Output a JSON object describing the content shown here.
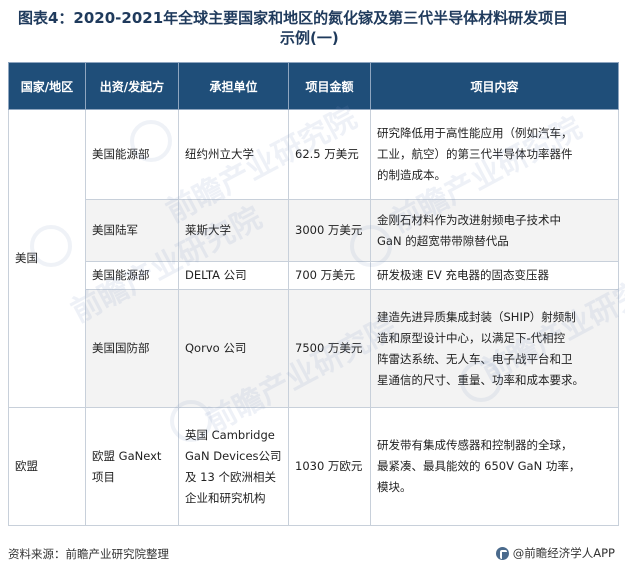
{
  "title": {
    "line1": "图表4：2020-2021年全球主要国家和地区的氮化镓及第三代半导体材料研发项目",
    "line2": "示例(一)"
  },
  "table": {
    "headers": [
      "国家/地区",
      "出资/发起方",
      "承担单位",
      "项目金额",
      "项目内容"
    ],
    "regions": {
      "usa": "美国",
      "europe": "欧盟"
    },
    "rows": [
      {
        "funder": "美国能源部",
        "unit": [
          "纽约州立大学"
        ],
        "amount": "62.5 万美元",
        "content": [
          "研究降低用于高性能应用（例如汽车，",
          "工业，航空）的第三代半导体功率器件",
          "的制造成本。"
        ]
      },
      {
        "funder": "美国陆军",
        "unit": [
          "莱斯大学"
        ],
        "amount": "3000 万美元",
        "content": [
          "金刚石材料作为改进射频电子技术中",
          "GaN 的超宽带带隙替代品"
        ]
      },
      {
        "funder": "美国能源部",
        "unit": [
          "DELTA 公司"
        ],
        "amount": "700 万美元",
        "content": [
          "研发极速 EV 充电器的固态变压器"
        ]
      },
      {
        "funder": "美国国防部",
        "unit": [
          "Qorvo 公司"
        ],
        "amount": "7500 万美元",
        "content": [
          "建造先进异质集成封装（SHIP）射频制",
          "造和原型设计中心，以满足下-代相控",
          "阵雷达系统、无人车、电子战平台和卫",
          "星通信的尺寸、重量、功率和成本要求。"
        ]
      },
      {
        "funder": [
          "欧盟 GaNext",
          "项目"
        ],
        "unit": [
          "英国 Cambridge",
          "GaN Devices公司",
          "及 13 个欧洲相关",
          "企业和研究机构"
        ],
        "amount": "1030 万欧元",
        "content": [
          "研发带有集成传感器和控制器的全球，",
          "最紧凑、最具能效的 650V GaN 功率，",
          "模块。"
        ]
      }
    ]
  },
  "footer": {
    "source": "资料来源：前瞻产业研究院整理",
    "brand": "@前瞻经济学人APP"
  },
  "watermark": {
    "text": "前瞻产业研究院"
  }
}
